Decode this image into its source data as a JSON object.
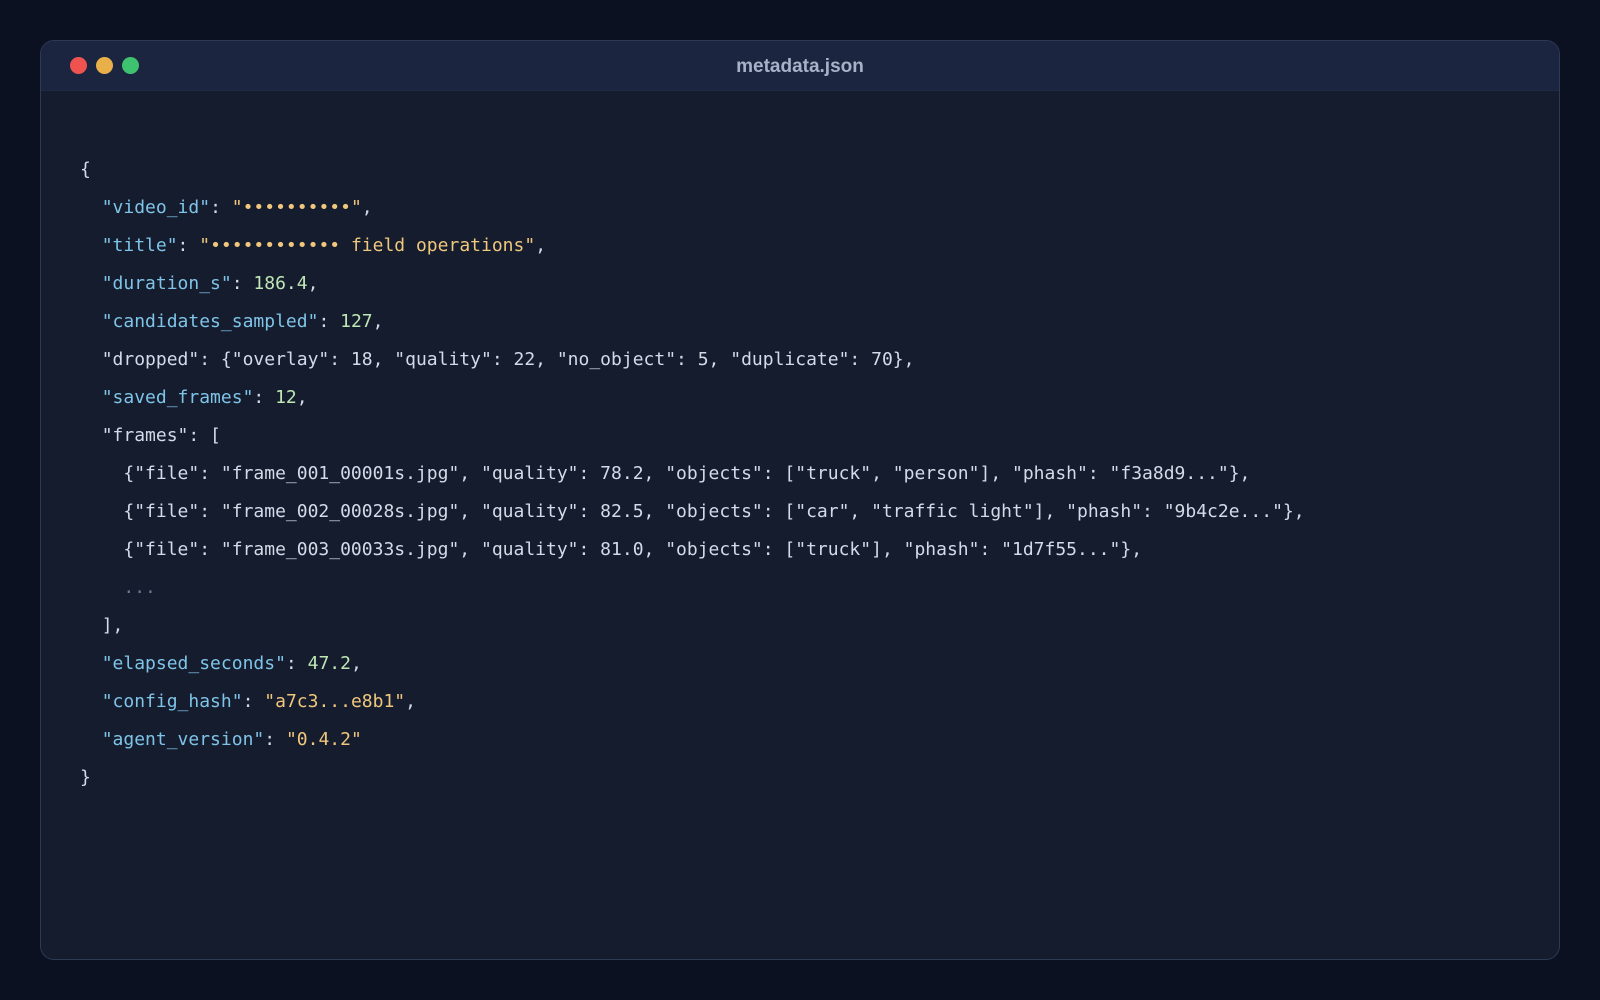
{
  "window": {
    "title": "metadata.json",
    "controls": [
      "close",
      "minimize",
      "maximize"
    ]
  },
  "json": {
    "open_brace": "{",
    "close_brace": "}",
    "video_id_key": "\"video_id\"",
    "video_id_value": "\"••••••••••\"",
    "title_key": "\"title\"",
    "title_value": "\"•••••••••••• field operations\"",
    "duration_key": "\"duration_s\"",
    "duration_value": "186.4",
    "candidates_key": "\"candidates_sampled\"",
    "candidates_value": "127",
    "dropped_line": "\"dropped\": {\"overlay\": 18, \"quality\": 22, \"no_object\": 5, \"duplicate\": 70},",
    "saved_frames_key": "\"saved_frames\"",
    "saved_frames_value": "12",
    "frames_open": "\"frames\": [",
    "frames": [
      "{\"file\": \"frame_001_00001s.jpg\", \"quality\": 78.2, \"objects\": [\"truck\", \"person\"], \"phash\": \"f3a8d9...\"},",
      "{\"file\": \"frame_002_00028s.jpg\", \"quality\": 82.5, \"objects\": [\"car\", \"traffic light\"], \"phash\": \"9b4c2e...\"},",
      "{\"file\": \"frame_003_00033s.jpg\", \"quality\": 81.0, \"objects\": [\"truck\"], \"phash\": \"1d7f55...\"},"
    ],
    "ellipsis": "...",
    "frames_close": "],",
    "elapsed_key": "\"elapsed_seconds\"",
    "elapsed_value": "47.2",
    "config_hash_key": "\"config_hash\"",
    "config_hash_value": "\"a7c3...e8b1\"",
    "agent_version_key": "\"agent_version\"",
    "agent_version_value": "\"0.4.2\""
  },
  "colors": {
    "background": "#0b1120",
    "panel": "#151c2e",
    "titlebar": "#1b2540",
    "key": "#7fc4e8",
    "string": "#f0c77c",
    "number": "#bfe7b4",
    "punctuation": "#d3dbe8"
  }
}
